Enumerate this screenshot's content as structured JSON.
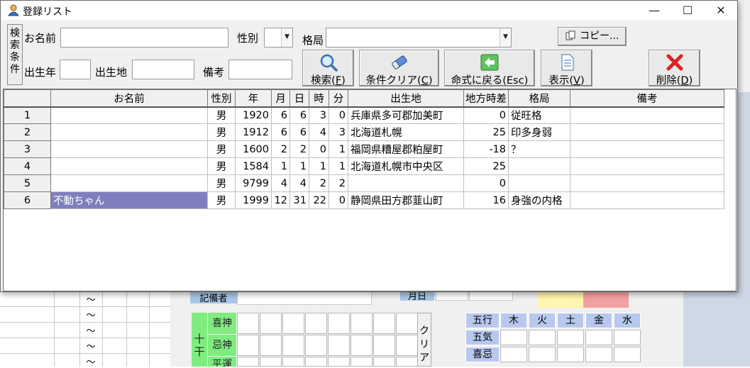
{
  "window": {
    "title": "登録リスト",
    "controls": {
      "minimize": "—",
      "maximize": "☐",
      "close": "✕"
    }
  },
  "search": {
    "condition_button": "検索条件",
    "name_label": "お名前",
    "name_value": "",
    "gender_label": "性別",
    "gender_value": "",
    "kakkyoku_label": "格局",
    "kakkyoku_value": "",
    "birthyear_label": "出生年",
    "birthyear_value": "",
    "birthplace_label": "出生地",
    "birthplace_value": "",
    "memo_label": "備考",
    "memo_value": ""
  },
  "toolbar": {
    "copy": "コピー...",
    "search": {
      "text": "検索(",
      "key": "F",
      "end": ")"
    },
    "clear": {
      "text": "条件クリア(",
      "key": "C",
      "end": ")"
    },
    "back": {
      "text": "命式に戻る(Esc)"
    },
    "show": {
      "text": "表示(",
      "key": "V",
      "end": ")"
    },
    "delete": {
      "text": "削除(",
      "key": "D",
      "end": ")"
    }
  },
  "table": {
    "columns": [
      "",
      "お名前",
      "性別",
      "年",
      "月",
      "日",
      "時",
      "分",
      "出生地",
      "地方時差",
      "格局",
      "備考"
    ],
    "rows": [
      [
        "1",
        "",
        "男",
        "1920",
        "6",
        "6",
        "3",
        "0",
        "兵庫県多可郡加美町",
        "0",
        "従旺格",
        ""
      ],
      [
        "2",
        "",
        "男",
        "1912",
        "6",
        "6",
        "4",
        "3",
        "北海道札幌",
        "25",
        "印多身弱",
        ""
      ],
      [
        "3",
        "",
        "男",
        "1600",
        "2",
        "2",
        "0",
        "1",
        "福岡県糟屋郡粕屋町",
        "-18",
        "？",
        ""
      ],
      [
        "4",
        "",
        "男",
        "1584",
        "1",
        "1",
        "1",
        "1",
        "北海道札幌市中央区",
        "25",
        "",
        ""
      ],
      [
        "5",
        "",
        "男",
        "9799",
        "4",
        "4",
        "2",
        "2",
        "",
        "0",
        "",
        ""
      ],
      [
        "6",
        "不動ちゃん",
        "男",
        "1999",
        "12",
        "31",
        "22",
        "0",
        "静岡県田方郡韮山町",
        "16",
        "身強の内格",
        ""
      ]
    ],
    "selected_row": 6
  },
  "background": {
    "memo_label": "記備者",
    "small_label": "月日",
    "tilde": "〜",
    "jukkan": "十干",
    "row_kishin": "喜神",
    "row_kijin": "忌神",
    "row_heiun": "平運",
    "clear_button": "クリア",
    "gogyo_header": [
      "五行",
      "木",
      "火",
      "土",
      "金",
      "水"
    ],
    "gogyo_rows": [
      "五気",
      "喜忌"
    ]
  },
  "colors": {
    "selection": "#7f7fbf",
    "green_label": "#80ec80",
    "blue_label": "#b8c8ee",
    "accent_yellow": "#fff6b0",
    "accent_red": "#f4a0a0"
  }
}
